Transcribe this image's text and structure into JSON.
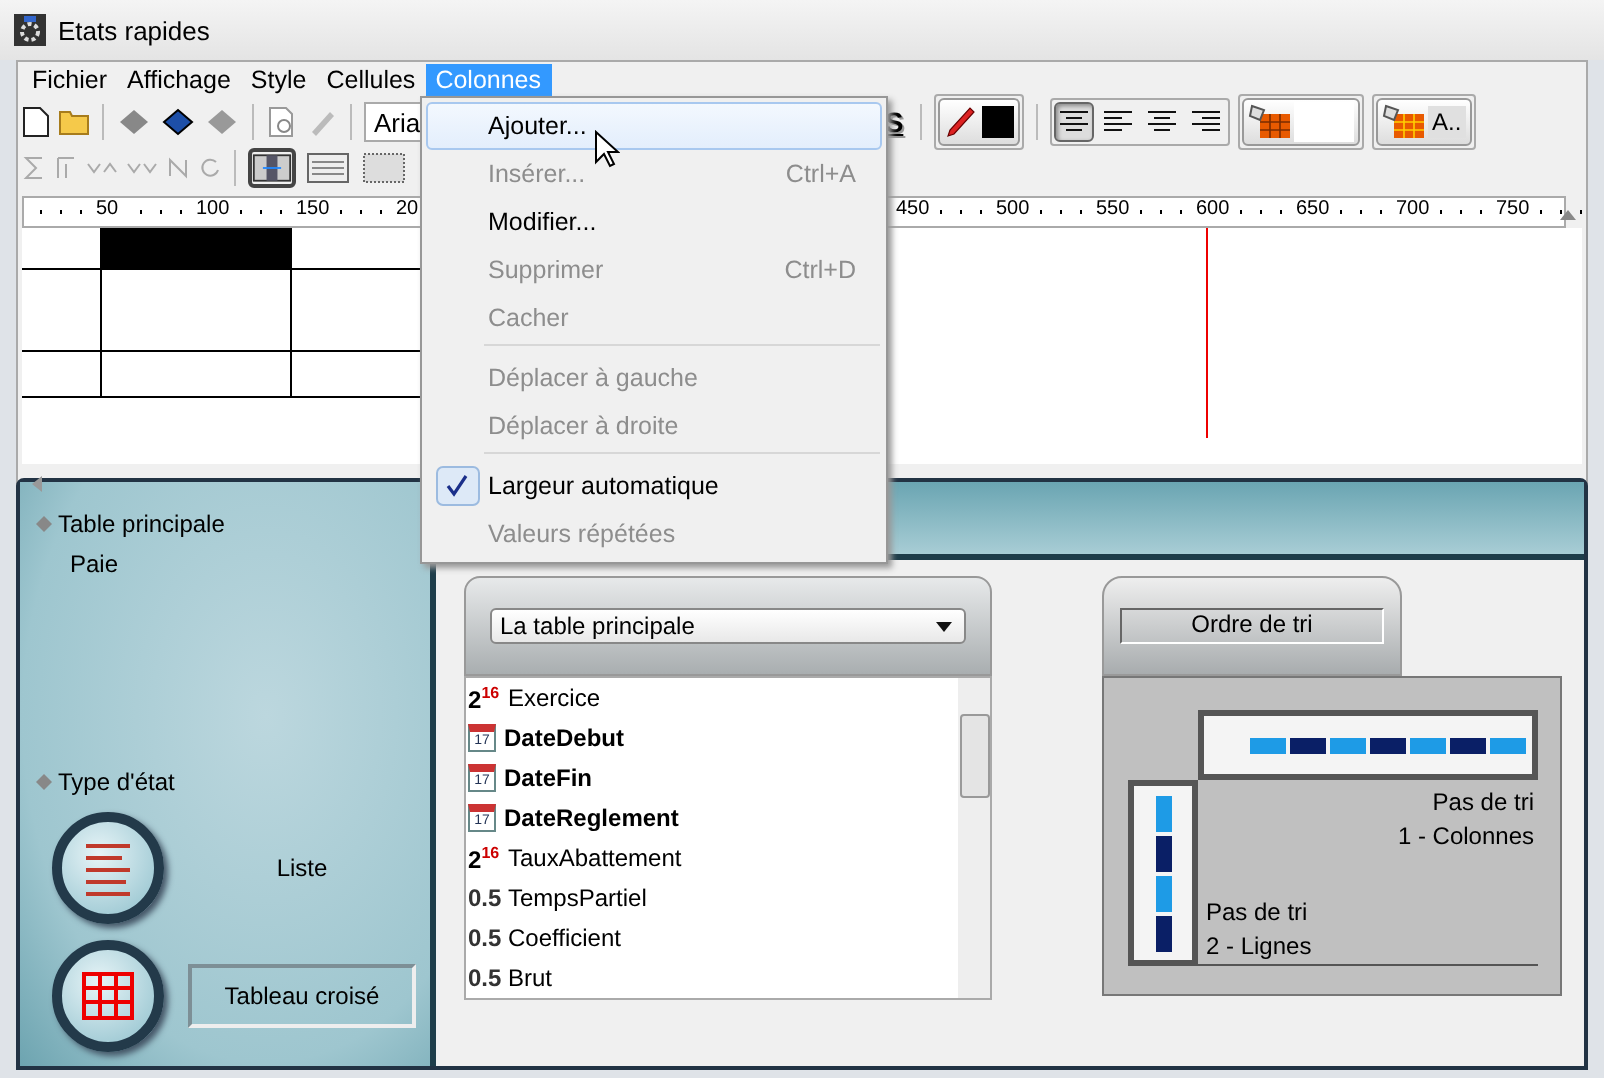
{
  "window": {
    "title": "Etats rapides"
  },
  "menu_bar": [
    {
      "label": "Fichier",
      "selected": false
    },
    {
      "label": "Affichage",
      "selected": false
    },
    {
      "label": "Style",
      "selected": false
    },
    {
      "label": "Cellules",
      "selected": false
    },
    {
      "label": "Colonnes",
      "selected": true
    }
  ],
  "toolbar": {
    "font_field": {
      "value": "Aria"
    },
    "style_button": {
      "label": "S"
    },
    "font_color_button": {
      "label": "A.."
    },
    "align_buttons": [
      {
        "kind": "standard",
        "selected": true
      },
      {
        "kind": "left",
        "selected": false
      },
      {
        "kind": "center",
        "selected": false
      },
      {
        "kind": "right",
        "selected": false
      }
    ],
    "view_buttons": [
      {
        "kind": "columns",
        "selected": true
      },
      {
        "kind": "rows",
        "selected": false
      },
      {
        "kind": "grid",
        "selected": false
      }
    ]
  },
  "ruler": {
    "labels": [
      "50",
      "100",
      "150",
      "20",
      "450",
      "500",
      "550",
      "600",
      "650",
      "700",
      "750"
    ]
  },
  "dropdown_menu": {
    "items": [
      {
        "label": "Ajouter...",
        "disabled": false,
        "checked": false,
        "selected": true
      },
      {
        "label": "Insérer...",
        "shortcut": "Ctrl+A",
        "disabled": true,
        "checked": false,
        "selected": false
      },
      {
        "label": "Modifier...",
        "disabled": false,
        "checked": false,
        "selected": false
      },
      {
        "label": "Supprimer",
        "shortcut": "Ctrl+D",
        "disabled": true,
        "checked": false,
        "selected": false
      },
      {
        "label": "Cacher",
        "disabled": true,
        "checked": false,
        "selected": false,
        "separator_after": true
      },
      {
        "label": "Déplacer à gauche",
        "disabled": true,
        "checked": false,
        "selected": false
      },
      {
        "label": "Déplacer à droite",
        "disabled": true,
        "checked": false,
        "selected": false,
        "separator_after": true
      },
      {
        "label": "Largeur automatique",
        "disabled": false,
        "checked": true,
        "selected": false
      },
      {
        "label": "Valeurs répétées",
        "disabled": true,
        "checked": false,
        "selected": false
      }
    ]
  },
  "left_panel": {
    "main_table": {
      "label": "Table principale",
      "value": "Paie"
    },
    "report_type": {
      "label": "Type d'état",
      "options": [
        {
          "kind": "list",
          "label": "Liste",
          "selected": false
        },
        {
          "kind": "crosstab",
          "label": "Tableau croisé",
          "selected": true
        }
      ]
    }
  },
  "field_list": {
    "table_select": {
      "value": "La table principale"
    },
    "fields": [
      {
        "name": "Exercice",
        "kind": "integer",
        "icon_text": "2$^{16}$",
        "bold": false
      },
      {
        "name": "DateDebut",
        "kind": "date",
        "icon_text": "17",
        "bold": true
      },
      {
        "name": "DateFin",
        "kind": "date",
        "icon_text": "17",
        "bold": true
      },
      {
        "name": "DateReglement",
        "kind": "date",
        "icon_text": "17",
        "bold": true
      },
      {
        "name": "TauxAbattement",
        "kind": "integer",
        "icon_text": "2$^{16}$",
        "bold": false
      },
      {
        "name": "TempsPartiel",
        "kind": "decimal",
        "icon_text": "0.5",
        "bold": false
      },
      {
        "name": "Coefficient",
        "kind": "decimal",
        "icon_text": "0.5",
        "bold": false
      },
      {
        "name": "Brut",
        "kind": "decimal",
        "icon_text": "0.5",
        "bold": false
      }
    ]
  },
  "sort_panel": {
    "title": "Ordre de tri",
    "columns_label": "Pas de tri",
    "columns_value": "1 - Colonnes",
    "rows_label": "Pas de tri",
    "rows_value": "2 - Lignes"
  }
}
